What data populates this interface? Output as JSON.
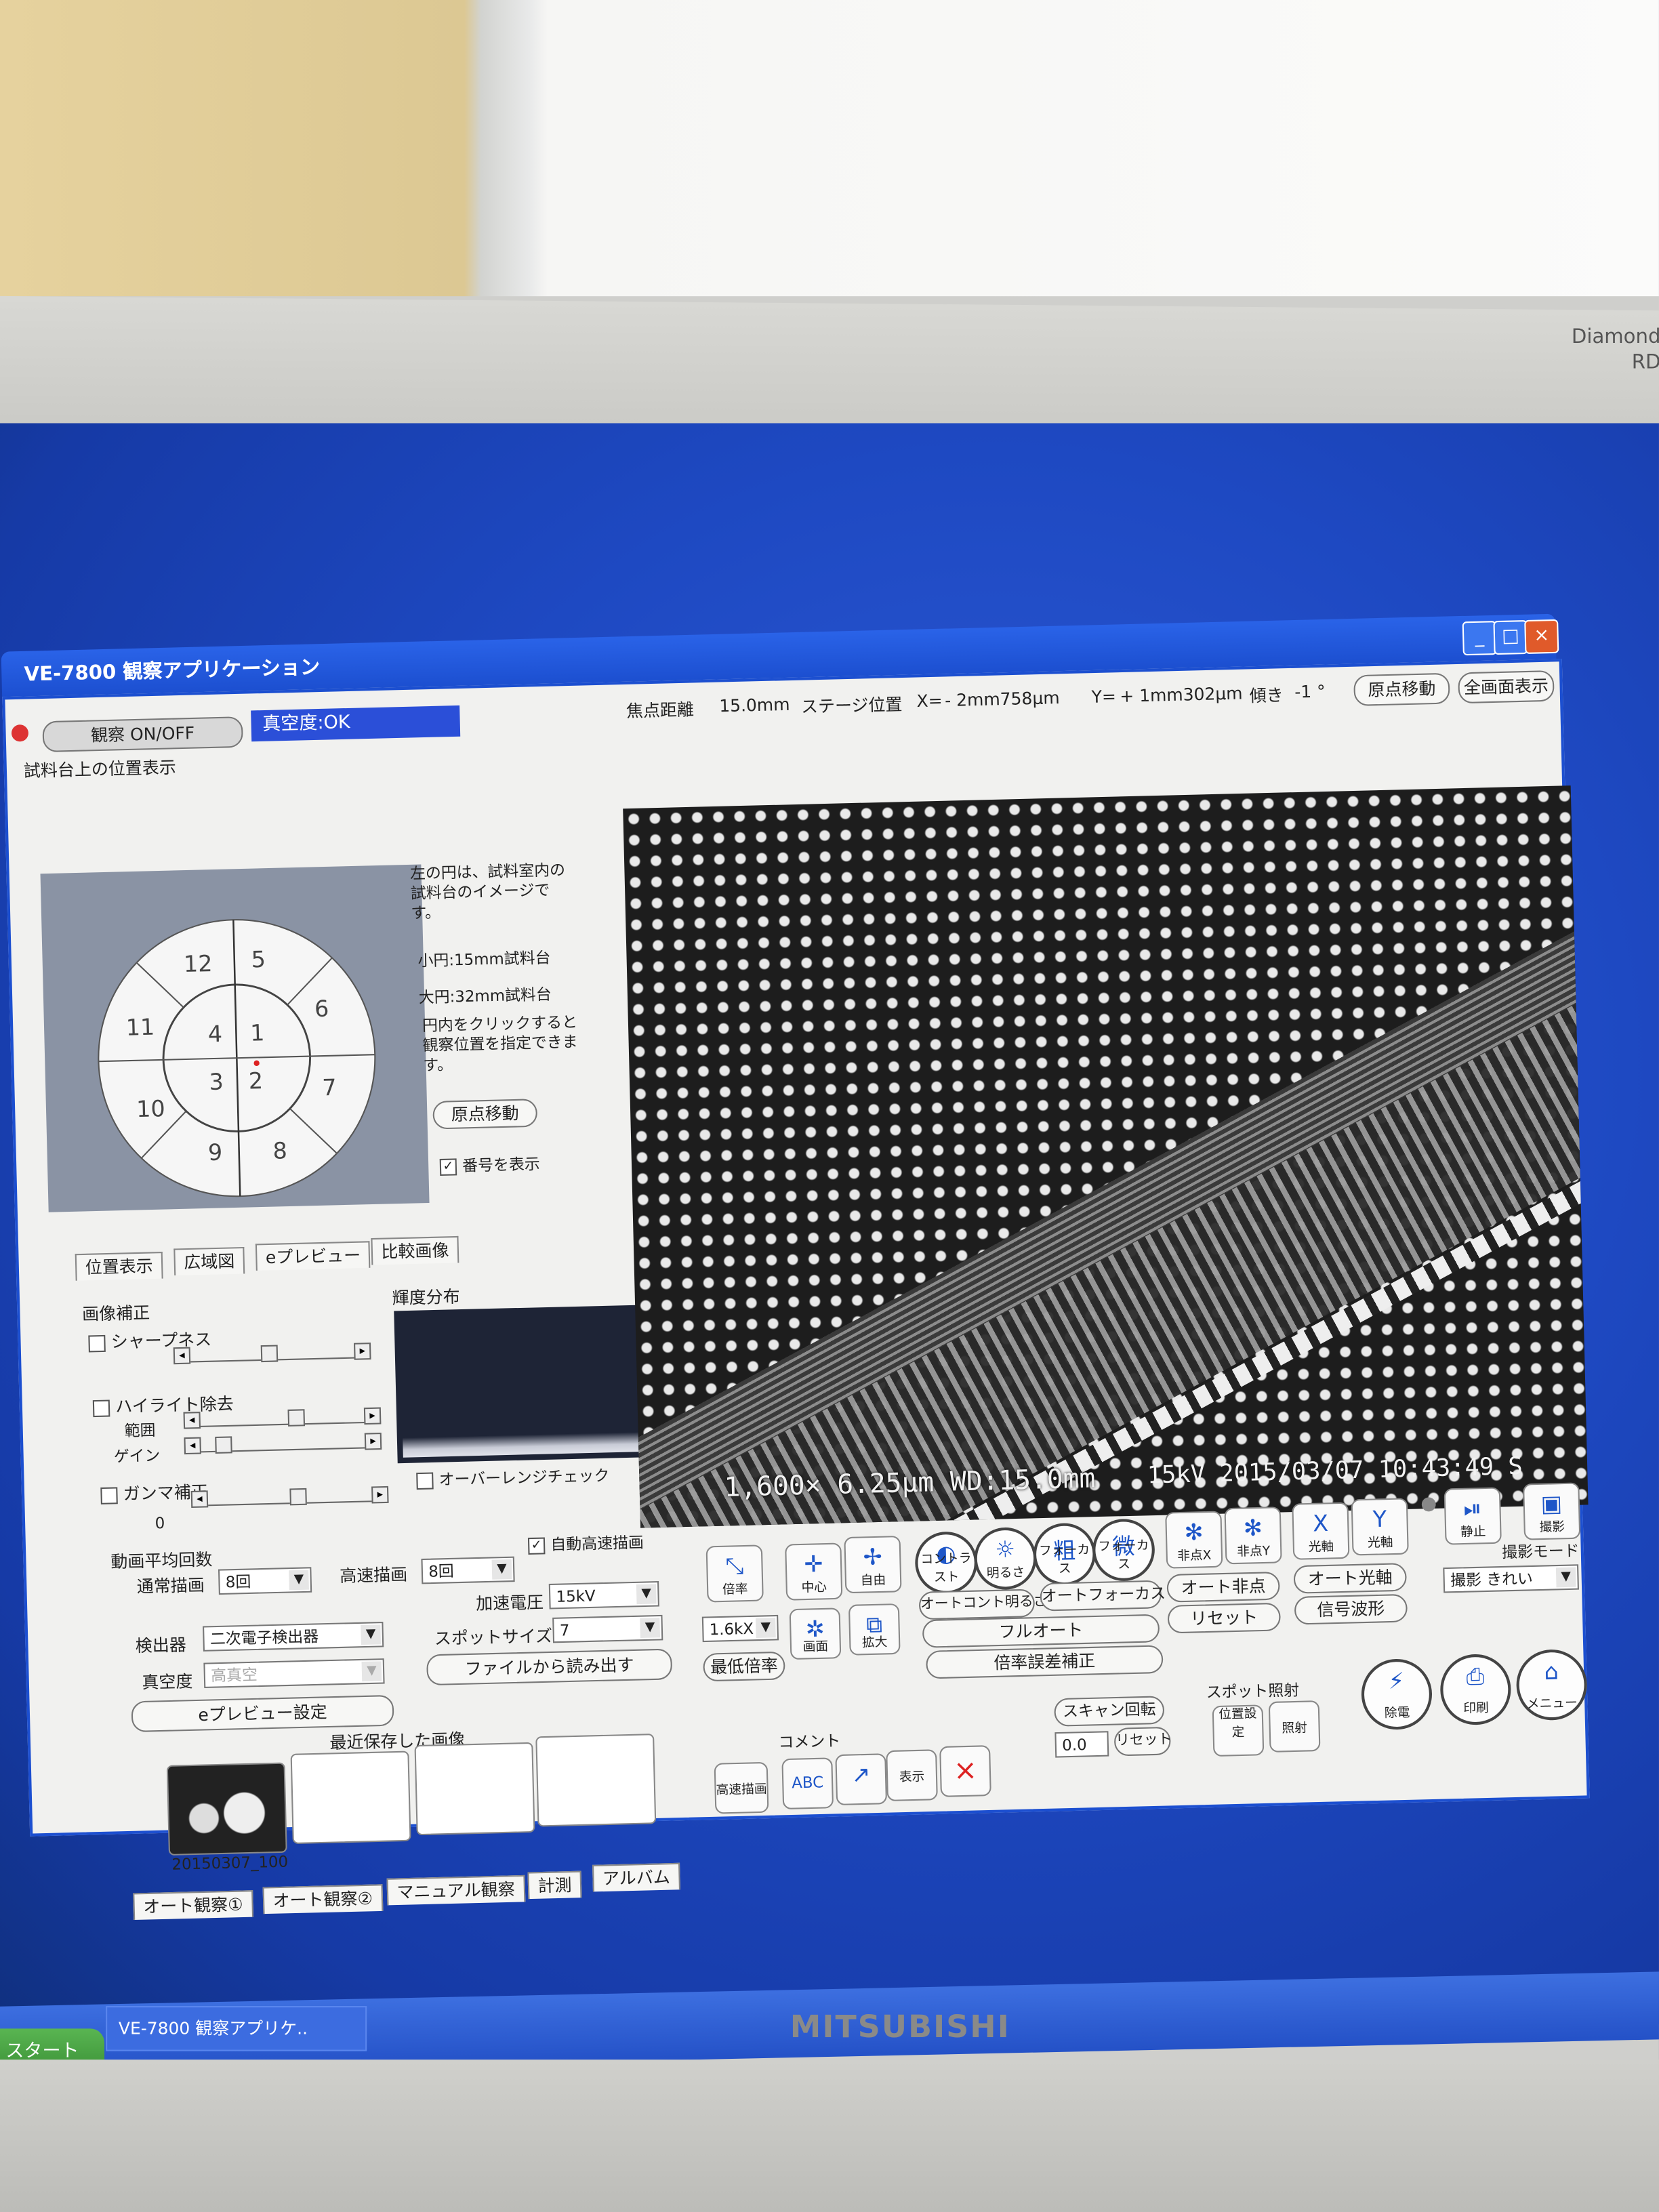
{
  "monitor": {
    "brand": "Diamond",
    "brand_line2": "RD",
    "maker": "MITSUBISHI"
  },
  "taskbar": {
    "start": "スタート",
    "item": "VE-7800 観察アプリケ.."
  },
  "window": {
    "title": "VE-7800 観察アプリケーション",
    "min": "_",
    "max": "□",
    "close": "×"
  },
  "top": {
    "observe_button": "観察 ON/OFF",
    "vacuum": "真空度:OK",
    "focal_label": "焦点距離",
    "focal_value": "15.0mm",
    "stage_label": "ステージ位置",
    "x_label": "X=",
    "x_value": "- 2mm758μm",
    "y_label": "Y=",
    "y_value": "+ 1mm302μm",
    "tilt_label": "傾き",
    "tilt_value": "-1 °",
    "origin_button": "原点移動",
    "full_button": "全画面表示"
  },
  "stage_panel": {
    "title": "試料台上の位置表示",
    "desc": "左の円は、試料室内の試料台のイメージです。",
    "small": "小円:15mm試料台",
    "large": "大円:32mm試料台",
    "click": "円内をクリックすると観察位置を指定できます。",
    "origin_button": "原点移動",
    "show_numbers": "番号を表示",
    "check_mark": "✓",
    "positions": [
      "1",
      "2",
      "3",
      "4",
      "5",
      "6",
      "7",
      "8",
      "9",
      "10",
      "11",
      "12"
    ]
  },
  "tabs": [
    "位置表示",
    "広域図",
    "eプレビュー",
    "比較画像"
  ],
  "image_correction": {
    "title": "画像補正",
    "sharpness": "シャープネス",
    "highlight": "ハイライト除去",
    "range": "範囲",
    "gain": "ゲイン",
    "gamma": "ガンマ補正",
    "gamma_value": "0"
  },
  "histogram": {
    "title": "輝度分布",
    "overrange": "オーバーレンジチェック"
  },
  "averaging": {
    "title": "動画平均回数",
    "normal": "通常描画",
    "normal_value": "8回",
    "fast": "高速描画",
    "fast_value": "8回",
    "auto_fast": "自動高速描画"
  },
  "voltage": {
    "label": "加速電圧",
    "value": "15kV"
  },
  "spot": {
    "label": "スポットサイズ",
    "value": "7"
  },
  "detector": {
    "label": "検出器",
    "value": "二次電子検出器"
  },
  "vacuum_sel": {
    "label": "真空度",
    "value": "高真空"
  },
  "buttons": {
    "load": "ファイルから読み出す",
    "epreview": "eプレビュー設定"
  },
  "recent": {
    "title": "最近保存した画像",
    "thumb_label": "20150307_100"
  },
  "bottom_tabs": [
    "オート観察①",
    "オート観察②",
    "マニュアル観察",
    "計測",
    "アルバム"
  ],
  "sem": {
    "magnification": "1,600×",
    "scale": "6.25μm",
    "wd": "WD:15.0mm",
    "kv": "15kV",
    "datetime": "2015/03/07 10:43:49",
    "mode": "S"
  },
  "controls": {
    "mag": "倍率",
    "center": "中心",
    "free": "自由",
    "contrast": "コントラスト",
    "brightness": "明るさ",
    "focus_coarse": "フォーカス",
    "focus_fine": "フォーカス",
    "coarse": "粗",
    "fine": "微",
    "astig_x": "非点X",
    "astig_y": "非点Y",
    "axis_x": "光軸",
    "axis_y": "光軸",
    "still": "静止",
    "capture": "撮影",
    "screen": "画面",
    "zoom": "拡大",
    "mag_value": "1.6kX",
    "min_mag": "最低倍率",
    "auto_cb": "オートコント明るさ",
    "auto_focus": "オートフォーカス",
    "full_auto": "フルオート",
    "mag_error": "倍率誤差補正",
    "auto_astig": "オート非点",
    "reset": "リセット",
    "auto_axis": "オート光軸",
    "signal_wave": "信号波形",
    "capture_mode_label": "撮影モード",
    "capture_mode_value": "撮影 きれい",
    "scan_rot": "スキャン回転",
    "rot_value": "0.0",
    "rot_reset": "リセット",
    "spot_irr": "スポット照射",
    "position_set": "位置設定",
    "irradiate": "照射",
    "discharge": "除電",
    "print": "印刷",
    "menu": "メニュー",
    "comment": "コメント",
    "fast_draw": "高速描画",
    "abc": "ABC",
    "arrow": "矢印",
    "show": "表示",
    "delete": "×"
  },
  "colors": {
    "title_blue": "#1c4fd0",
    "desktop": "#1e49c2",
    "panel": "#f1f1ef"
  }
}
